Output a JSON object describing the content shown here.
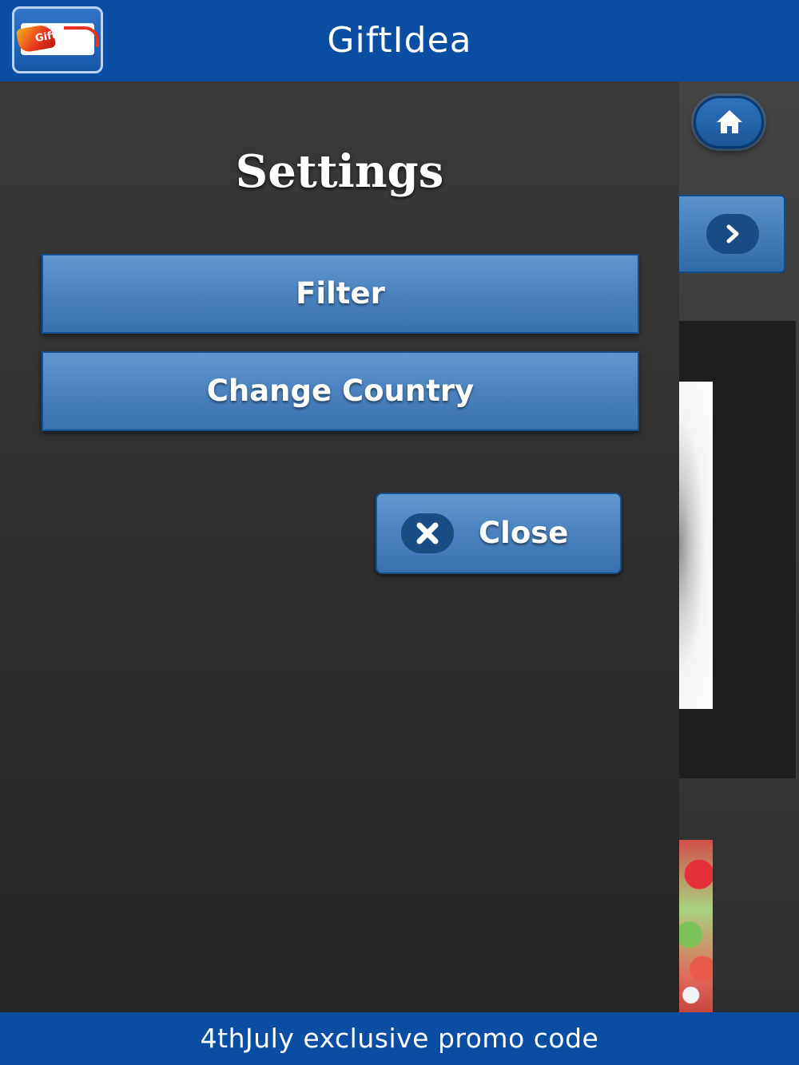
{
  "header": {
    "title": "GiftIdea",
    "logo_icon": "gift-logo-icon",
    "logo_mark_text": "Gift"
  },
  "background": {
    "home_icon": "home-icon",
    "next_icon": "chevron-right-icon"
  },
  "settings": {
    "title": "Settings",
    "buttons": [
      {
        "label": "Filter"
      },
      {
        "label": "Change Country"
      }
    ],
    "close": {
      "label": "Close",
      "icon": "close-icon"
    }
  },
  "promo": {
    "text": "4thJuly exclusive promo code"
  },
  "colors": {
    "bar": "#0a4ea3",
    "button": "#4a83c0",
    "button_border": "#164f8f",
    "panel": "#2c2c2c"
  }
}
